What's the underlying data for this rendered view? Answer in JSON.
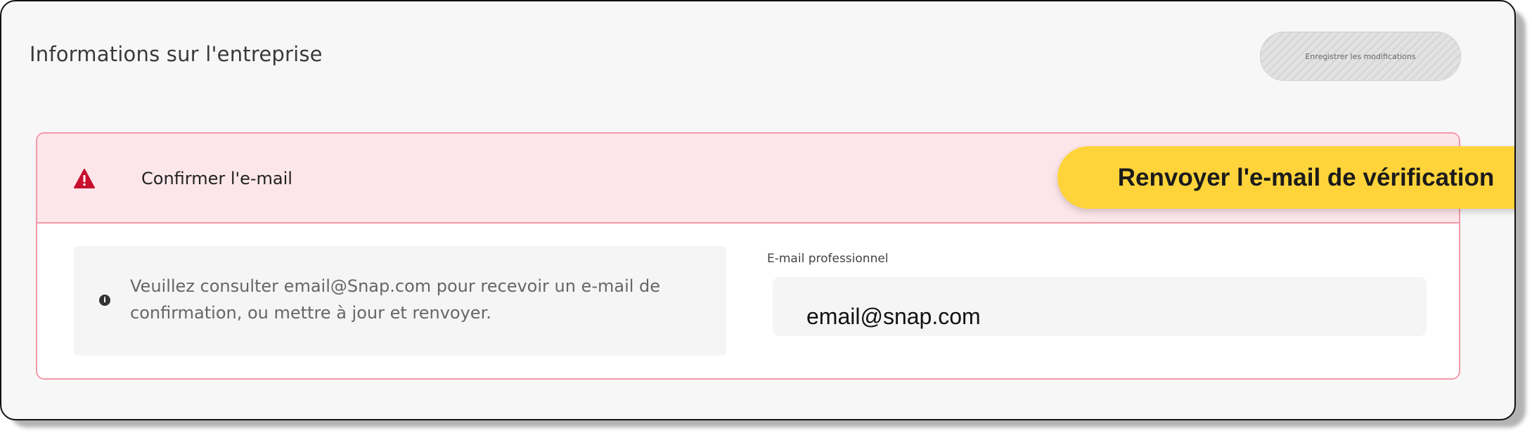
{
  "header": {
    "title": "Informations sur l'entreprise",
    "save_label": "Enregistrer les modifications"
  },
  "banner": {
    "title": "Confirmer l'e-mail",
    "resend_label": "Renvoyer l'e-mail de vérification"
  },
  "info": {
    "message": "Veuillez consulter email@Snap.com pour recevoir un e-mail de confirmation, ou mettre à jour et renvoyer."
  },
  "email_field": {
    "label": "E-mail professionnel",
    "value": "email@snap.com"
  },
  "colors": {
    "banner_bg": "#fde6ea",
    "card_border": "#f29aa8",
    "warning": "#c8102e",
    "accent": "#ffd43b"
  },
  "icons": {
    "warning": "warning-triangle-icon",
    "info": "info-circle-icon"
  }
}
